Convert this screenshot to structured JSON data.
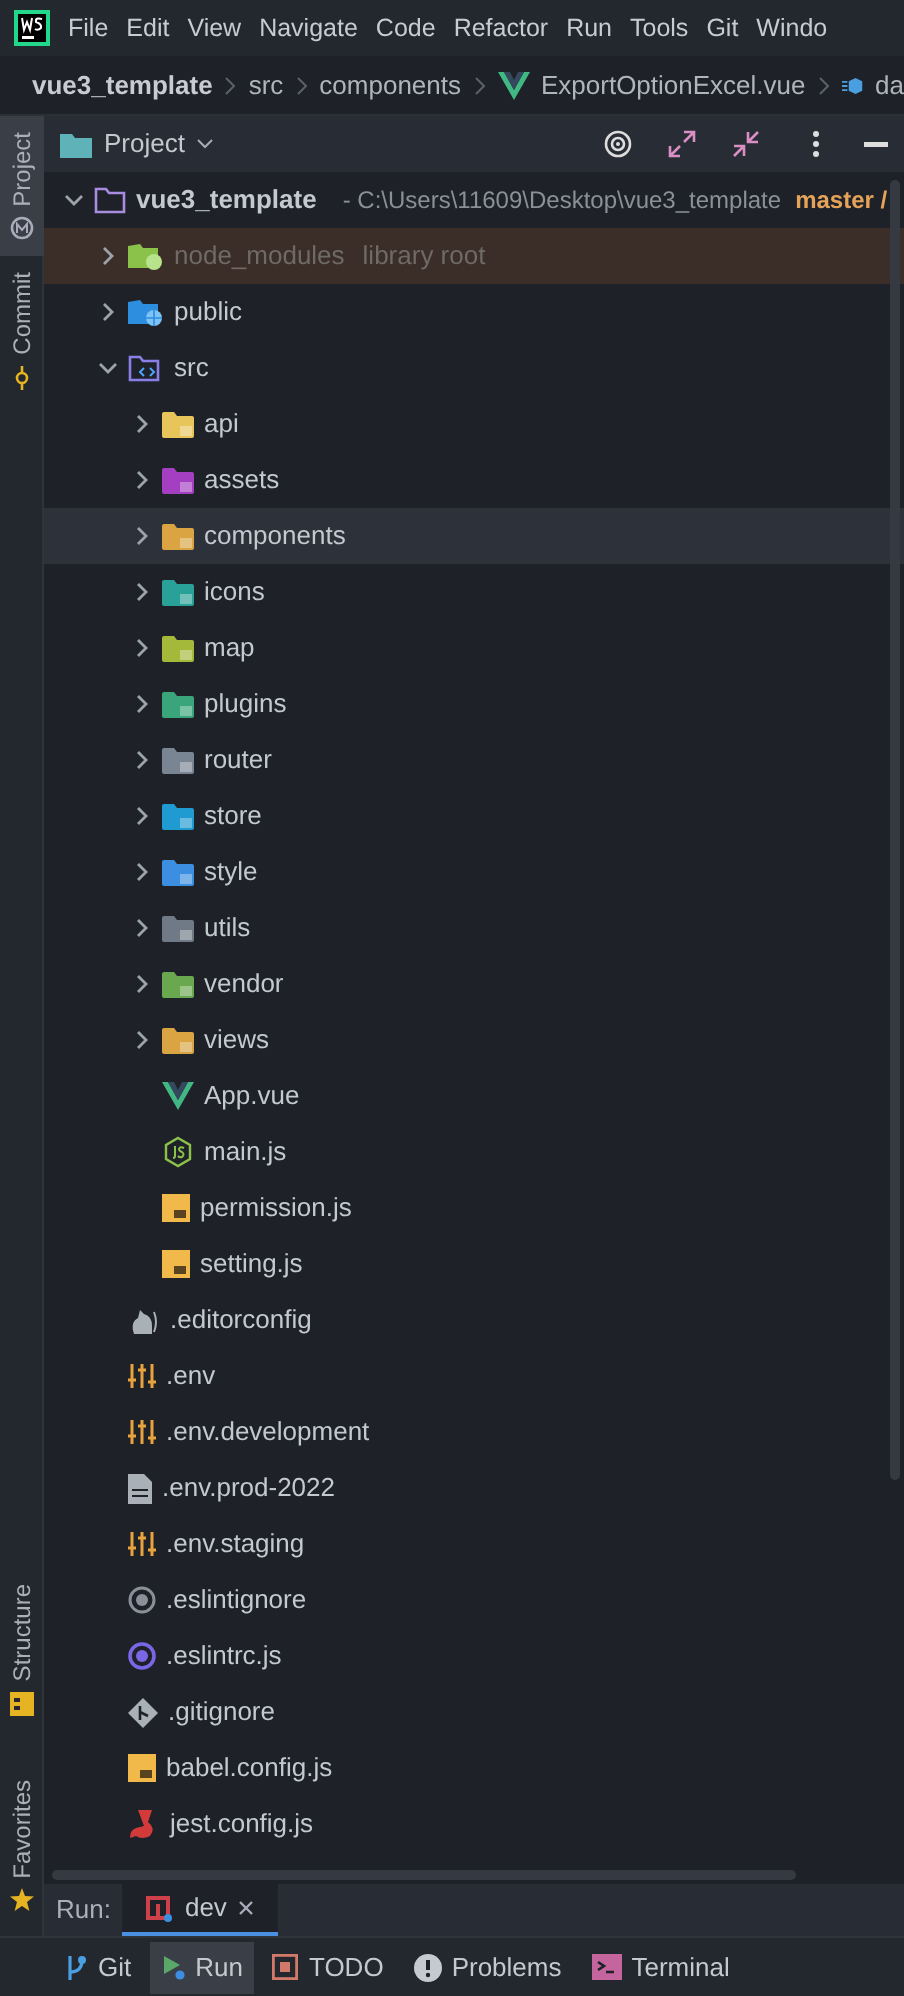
{
  "menu_bar": {
    "items": [
      "File",
      "Edit",
      "View",
      "Navigate",
      "Code",
      "Refactor",
      "Run",
      "Tools",
      "Git",
      "Windo"
    ]
  },
  "breadcrumbs": [
    {
      "label": "vue3_template",
      "kind": "project"
    },
    {
      "label": "src",
      "kind": "folder"
    },
    {
      "label": "components",
      "kind": "folder"
    },
    {
      "label": "ExportOptionExcel.vue",
      "kind": "vue"
    },
    {
      "label": "da",
      "kind": "data"
    }
  ],
  "side_tabs_top": [
    {
      "label": "Project",
      "kind": "project",
      "selected": true
    },
    {
      "label": "Commit",
      "kind": "commit",
      "selected": false
    }
  ],
  "side_tabs_bottom": [
    {
      "label": "Structure",
      "kind": "structure",
      "selected": false
    },
    {
      "label": "Favorites",
      "kind": "favorites",
      "selected": false
    }
  ],
  "project_panel": {
    "title": "Project"
  },
  "tree": [
    {
      "name": "vue3_template",
      "kind": "root",
      "expanded": true,
      "selected": false,
      "path": "- C:\\Users\\11609\\Desktop\\vue3_template",
      "branch": "master /",
      "children": [
        {
          "name": "node_modules",
          "kind": "node",
          "expanded": false,
          "selected": false,
          "suffix": "library root"
        },
        {
          "name": "public",
          "kind": "web",
          "expanded": false,
          "selected": false
        },
        {
          "name": "src",
          "kind": "src",
          "expanded": true,
          "selected": false,
          "children": [
            {
              "name": "api",
              "kind": "folder",
              "color": "#e8c55a",
              "expanded": false,
              "selected": false
            },
            {
              "name": "assets",
              "kind": "folder",
              "color": "#a33fc0",
              "expanded": false,
              "selected": false
            },
            {
              "name": "components",
              "kind": "folder",
              "color": "#d9a441",
              "expanded": false,
              "selected": true
            },
            {
              "name": "icons",
              "kind": "folder",
              "color": "#2aa198",
              "expanded": false,
              "selected": false
            },
            {
              "name": "map",
              "kind": "folder",
              "color": "#a4b93a",
              "expanded": false,
              "selected": false
            },
            {
              "name": "plugins",
              "kind": "folder",
              "color": "#3aa57a",
              "expanded": false,
              "selected": false
            },
            {
              "name": "router",
              "kind": "folder",
              "color": "#7a8594",
              "expanded": false,
              "selected": false
            },
            {
              "name": "store",
              "kind": "folder",
              "color": "#1f9bd1",
              "expanded": false,
              "selected": false
            },
            {
              "name": "style",
              "kind": "folder",
              "color": "#3c8fe0",
              "expanded": false,
              "selected": false
            },
            {
              "name": "utils",
              "kind": "folder",
              "color": "#6f7a86",
              "expanded": false,
              "selected": false
            },
            {
              "name": "vendor",
              "kind": "folder",
              "color": "#6aa84f",
              "expanded": false,
              "selected": false
            },
            {
              "name": "views",
              "kind": "folder",
              "color": "#d9a441",
              "expanded": false,
              "selected": false
            },
            {
              "name": "App.vue",
              "kind": "vue",
              "selected": false
            },
            {
              "name": "main.js",
              "kind": "nodejs",
              "selected": false
            },
            {
              "name": "permission.js",
              "kind": "js",
              "selected": false
            },
            {
              "name": "setting.js",
              "kind": "js",
              "selected": false
            }
          ]
        },
        {
          "name": ".editorconfig",
          "kind": "editorconfig",
          "selected": false
        },
        {
          "name": ".env",
          "kind": "env",
          "selected": false
        },
        {
          "name": ".env.development",
          "kind": "env",
          "selected": false
        },
        {
          "name": ".env.prod-2022",
          "kind": "text",
          "selected": false
        },
        {
          "name": ".env.staging",
          "kind": "env",
          "selected": false
        },
        {
          "name": ".eslintignore",
          "kind": "ignore",
          "selected": false
        },
        {
          "name": ".eslintrc.js",
          "kind": "eslint",
          "selected": false
        },
        {
          "name": ".gitignore",
          "kind": "git",
          "selected": false
        },
        {
          "name": "babel.config.js",
          "kind": "js",
          "selected": false
        },
        {
          "name": "jest.config.js",
          "kind": "jest",
          "selected": false
        }
      ]
    }
  ],
  "run_bar": {
    "label": "Run:",
    "tabs": [
      {
        "label": "dev",
        "selected": true
      }
    ]
  },
  "bottom_tabs": [
    {
      "label": "Git",
      "kind": "git",
      "selected": false
    },
    {
      "label": "Run",
      "kind": "run",
      "selected": true
    },
    {
      "label": "TODO",
      "kind": "todo",
      "selected": false
    },
    {
      "label": "Problems",
      "kind": "problems",
      "selected": false
    },
    {
      "label": "Terminal",
      "kind": "terminal",
      "selected": false
    }
  ]
}
